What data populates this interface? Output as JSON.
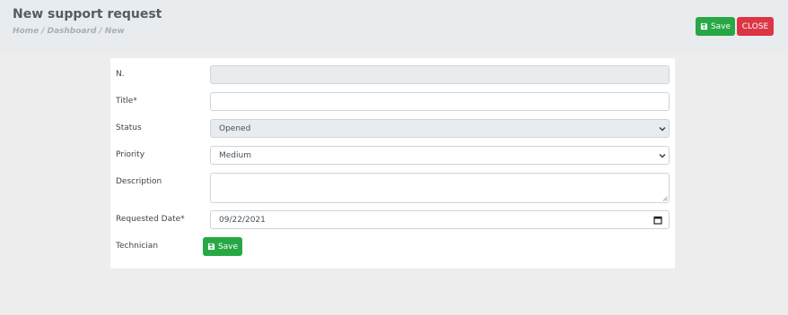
{
  "header": {
    "title": "New support request",
    "breadcrumb": [
      "Home",
      "Dashboard",
      "New"
    ],
    "breadcrumb_separator": "/",
    "save_label": "Save",
    "close_label": "CLOSE"
  },
  "form": {
    "number": {
      "label": "N.",
      "value": ""
    },
    "title": {
      "label": "Title*",
      "value": ""
    },
    "status": {
      "label": "Status",
      "value": "Opened"
    },
    "priority": {
      "label": "Priority",
      "value": "Medium"
    },
    "description": {
      "label": "Description",
      "value": ""
    },
    "requested_date": {
      "label": "Requested Date*",
      "value": "09/22/2021"
    },
    "technician": {
      "label": "Technician"
    },
    "save_label": "Save"
  },
  "colors": {
    "success": "#28a745",
    "danger": "#dc3545",
    "header_bg": "#e9ecef",
    "page_bg": "#ededed"
  },
  "icons": {
    "save": "floppy-disk-icon",
    "dropdown": "chevron-down-icon",
    "calendar": "calendar-icon"
  }
}
